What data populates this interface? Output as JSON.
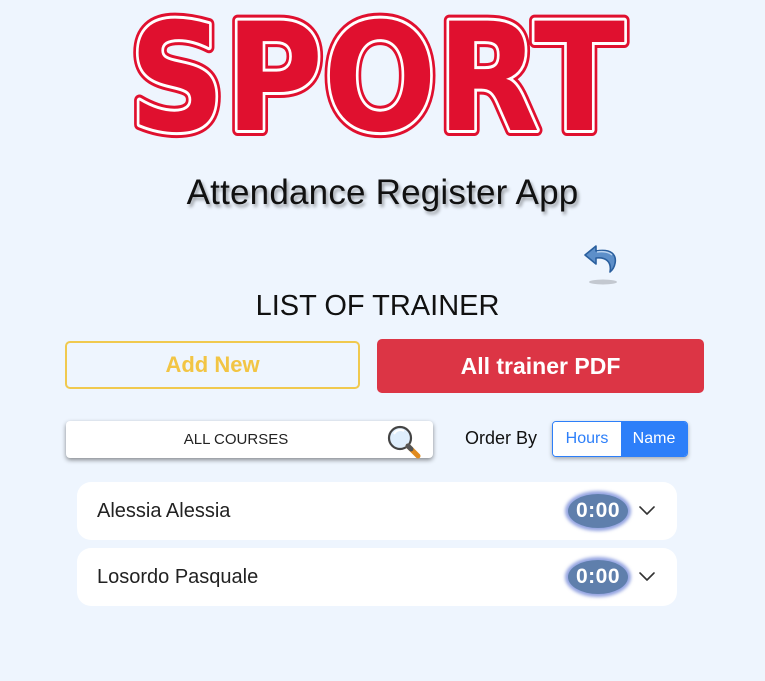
{
  "logo": {
    "text": "SPORT",
    "fill_color": "#e0102f",
    "outline_color": "#e0102f"
  },
  "app_title": "Attendance Register App",
  "back_icon": "undo-arrow-icon",
  "section_title": "LIST OF TRAINER",
  "actions": {
    "add_new_label": "Add New",
    "pdf_label": "All trainer PDF"
  },
  "filter": {
    "course_value": "ALL COURSES",
    "search_icon": "magnifier-icon",
    "order_by_label": "Order By",
    "order_options": [
      "Hours",
      "Name"
    ],
    "selected_order": "Name"
  },
  "trainers": [
    {
      "name": "Alessia Alessia",
      "hours": "0:00"
    },
    {
      "name": "Losordo Pasquale",
      "hours": "0:00"
    }
  ],
  "colors": {
    "background": "#eef5fe",
    "brand_red": "#dc3545",
    "add_yellow": "#f2c544",
    "segment_blue": "#2d7ff9",
    "badge": "#5f7fac"
  }
}
